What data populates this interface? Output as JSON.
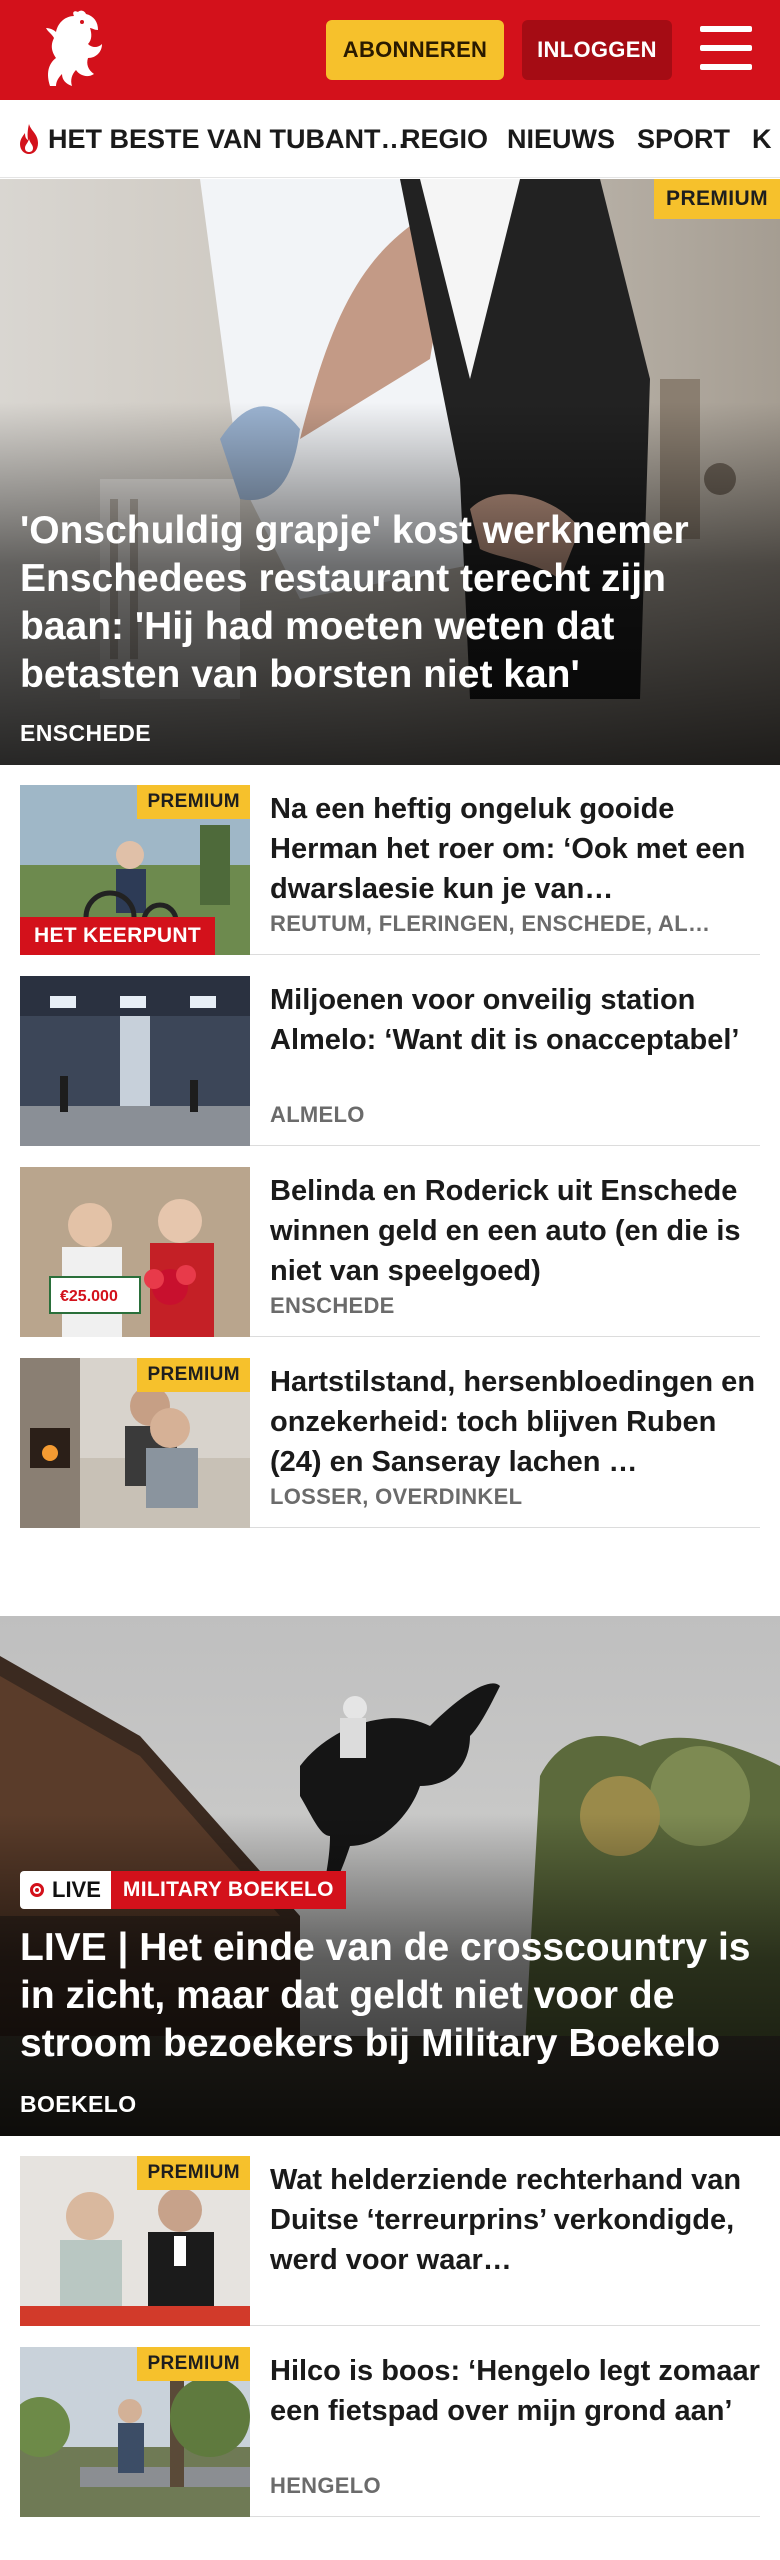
{
  "header": {
    "logo": "tubantia-horse-logo",
    "subscribe_label": "ABONNEREN",
    "login_label": "INLOGGEN",
    "menu_icon": "hamburger-icon"
  },
  "nav": {
    "items": [
      {
        "label": "HET BESTE VAN TUBANT…",
        "icon": "flame-icon"
      },
      {
        "label": "REGIO"
      },
      {
        "label": "NIEUWS"
      },
      {
        "label": "SPORT"
      },
      {
        "label": "K"
      }
    ]
  },
  "hero1": {
    "badge": "PREMIUM",
    "title": "'Onschuldig grapje' kost werknemer Enschedees restaurant terecht zijn baan: 'Hij had moeten weten dat betasten van borsten niet kan'",
    "location": "ENSCHEDE"
  },
  "list1": [
    {
      "title": "Na een heftig ongeluk gooide Herman het roer om: ‘Ook met een dwarslaesie kun je van…",
      "location": "REUTUM, FLERINGEN, ENSCHEDE, AL…",
      "premium": "PREMIUM",
      "kicker": "HET KEERPUNT"
    },
    {
      "title": "Miljoenen voor onveilig station Almelo: ‘Want dit is onacceptabel’",
      "location": "ALMELO"
    },
    {
      "title": "Belinda en Roderick uit Enschede winnen geld en een auto (en die is niet van speelgoed)",
      "location": "ENSCHEDE",
      "cheque": "€25.000"
    },
    {
      "title": "Hartstilstand, hersenbloedingen en onzekerheid: toch blijven Ruben (24) en Sanseray lachen …",
      "location": "LOSSER, OVERDINKEL",
      "premium": "PREMIUM"
    }
  ],
  "hero2": {
    "live_label": "LIVE",
    "category": "MILITARY BOEKELO",
    "title": "LIVE | Het einde van de crosscountry is in zicht, maar dat geldt niet voor de stroom bezoekers bij Military Boekelo",
    "location": "BOEKELO"
  },
  "list2": [
    {
      "title": "Wat helderziende rechterhand van Duitse ‘terreurprins’ verkondigde, werd voor waar…",
      "location": "",
      "premium": "PREMIUM"
    },
    {
      "title": "Hilco is boos: ‘Hengelo legt zomaar een fietspad over mijn grond aan’",
      "location": "HENGELO",
      "premium": "PREMIUM"
    }
  ],
  "colors": {
    "brand_red": "#d3111b",
    "dark_red": "#a50c14",
    "premium_yellow": "#f6c12c"
  }
}
